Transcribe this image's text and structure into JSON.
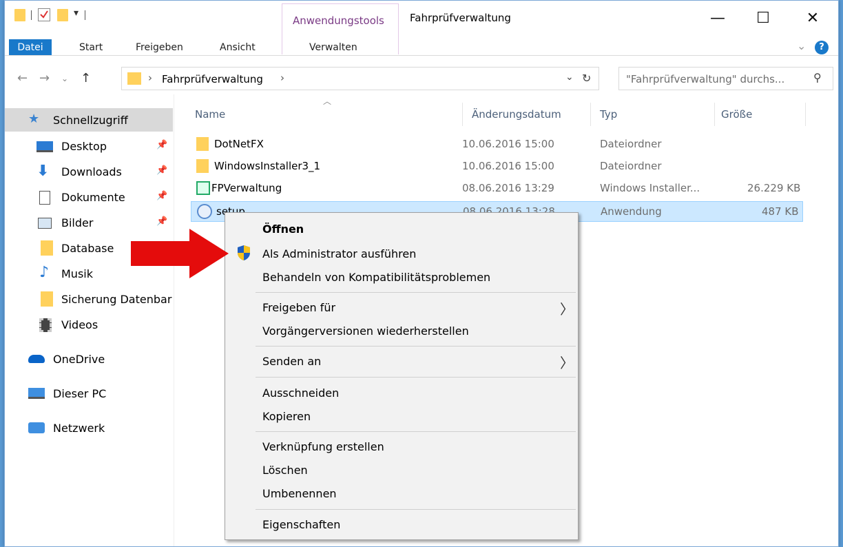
{
  "window": {
    "title": "Fahrprüfverwaltung",
    "min": "—",
    "max": "☐",
    "close": "✕"
  },
  "ribbon": {
    "context_group": "Anwendungstools",
    "context_tab": "Verwalten",
    "tabs": [
      "Datei",
      "Start",
      "Freigeben",
      "Ansicht"
    ],
    "help": "?",
    "expand": "⌄"
  },
  "address": {
    "path": "Fahrprüfverwaltung",
    "sep": "›",
    "search_placeholder": "\"Fahrprüfverwaltung\" durchs..."
  },
  "sidebar": {
    "quick_access": "Schnellzugriff",
    "items": [
      "Desktop",
      "Downloads",
      "Dokumente",
      "Bilder",
      "Database",
      "Musik",
      "Sicherung Datenbar",
      "Videos"
    ],
    "onedrive": "OneDrive",
    "thispc": "Dieser PC",
    "network": "Netzwerk"
  },
  "columns": {
    "name": "Name",
    "date": "Änderungsdatum",
    "type": "Typ",
    "size": "Größe"
  },
  "files": [
    {
      "name": "DotNetFX",
      "date": "10.06.2016 15:00",
      "type": "Dateiordner",
      "size": ""
    },
    {
      "name": "WindowsInstaller3_1",
      "date": "10.06.2016 15:00",
      "type": "Dateiordner",
      "size": ""
    },
    {
      "name": "FPVerwaltung",
      "date": "08.06.2016 13:29",
      "type": "Windows Installer...",
      "size": "26.229 KB"
    },
    {
      "name": "setup",
      "date": "08.06.2016 13:28",
      "type": "Anwendung",
      "size": "487 KB"
    }
  ],
  "menu": {
    "open": "Öffnen",
    "run_admin": "Als Administrator ausführen",
    "compat": "Behandeln von Kompatibilitätsproblemen",
    "share": "Freigeben für",
    "restore": "Vorgängerversionen wiederherstellen",
    "send": "Senden an",
    "cut": "Ausschneiden",
    "copy": "Kopieren",
    "shortcut": "Verknüpfung erstellen",
    "delete": "Löschen",
    "rename": "Umbenennen",
    "props": "Eigenschaften",
    "submenu_chevron": "〉"
  },
  "colors": {
    "accent": "#1979ca",
    "selection": "#cce8ff",
    "arrow": "#e40c0c",
    "folder": "#ffd15c"
  }
}
